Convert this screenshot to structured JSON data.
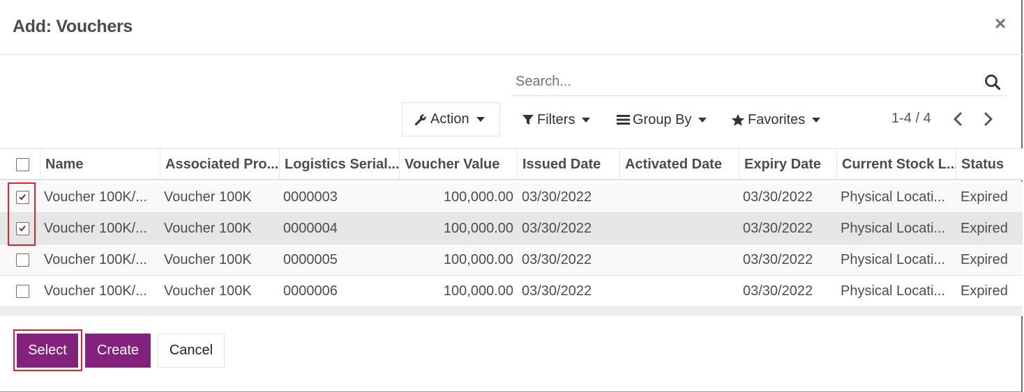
{
  "dialog": {
    "title": "Add: Vouchers",
    "close_label": "×"
  },
  "search": {
    "placeholder": "Search..."
  },
  "toolbar": {
    "action_label": "Action",
    "filters_label": "Filters",
    "groupby_label": "Group By",
    "favorites_label": "Favorites"
  },
  "pager": {
    "value": "1-4 / 4"
  },
  "table": {
    "columns": [
      "Name",
      "Associated Pro...",
      "Logistics Serial...",
      "Voucher Value",
      "Issued Date",
      "Activated Date",
      "Expiry Date",
      "Current Stock L...",
      "Status"
    ],
    "rows": [
      {
        "checked": true,
        "name": "Voucher 100K/...",
        "product": "Voucher 100K",
        "serial": "0000003",
        "value": "100,000.00",
        "issued": "03/30/2022",
        "activated": "",
        "expiry": "03/30/2022",
        "location": "Physical Locati...",
        "status": "Expired"
      },
      {
        "checked": true,
        "name": "Voucher 100K/...",
        "product": "Voucher 100K",
        "serial": "0000004",
        "value": "100,000.00",
        "issued": "03/30/2022",
        "activated": "",
        "expiry": "03/30/2022",
        "location": "Physical Locati...",
        "status": "Expired"
      },
      {
        "checked": false,
        "name": "Voucher 100K/...",
        "product": "Voucher 100K",
        "serial": "0000005",
        "value": "100,000.00",
        "issued": "03/30/2022",
        "activated": "",
        "expiry": "03/30/2022",
        "location": "Physical Locati...",
        "status": "Expired"
      },
      {
        "checked": false,
        "name": "Voucher 100K/...",
        "product": "Voucher 100K",
        "serial": "0000006",
        "value": "100,000.00",
        "issued": "03/30/2022",
        "activated": "",
        "expiry": "03/30/2022",
        "location": "Physical Locati...",
        "status": "Expired"
      }
    ]
  },
  "footer": {
    "select_label": "Select",
    "create_label": "Create",
    "cancel_label": "Cancel"
  },
  "colors": {
    "primary": "#84217e",
    "highlight_box": "#e0232a"
  }
}
